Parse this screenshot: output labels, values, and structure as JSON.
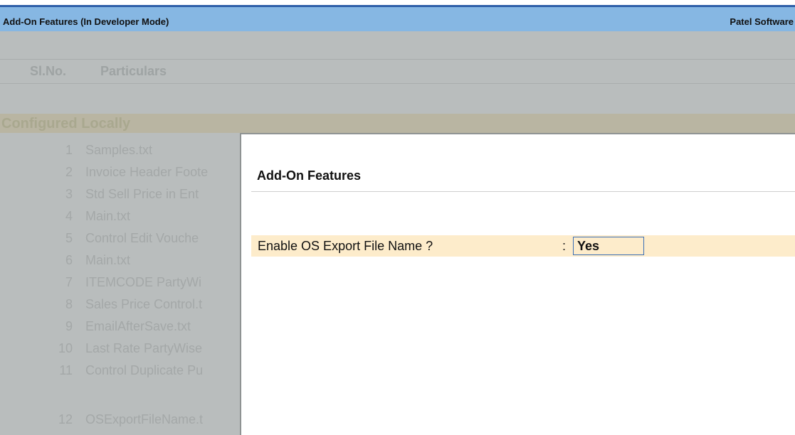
{
  "header": {
    "title": "Add-On Features (In Developer Mode)",
    "company": "Patel Software"
  },
  "list": {
    "col_slno": "Sl.No.",
    "col_particulars": "Particulars",
    "section": "Configured Locally",
    "rows": [
      {
        "num": "1",
        "name": "Samples.txt"
      },
      {
        "num": "2",
        "name": "Invoice Header Foote"
      },
      {
        "num": "3",
        "name": "Std Sell Price in Ent"
      },
      {
        "num": "4",
        "name": "Main.txt"
      },
      {
        "num": "5",
        "name": "Control Edit Vouche"
      },
      {
        "num": "6",
        "name": "Main.txt"
      },
      {
        "num": "7",
        "name": "ITEMCODE PartyWi"
      },
      {
        "num": "8",
        "name": "Sales Price Control.t"
      },
      {
        "num": "9",
        "name": "EmailAfterSave.txt"
      },
      {
        "num": "10",
        "name": "Last Rate PartyWise"
      },
      {
        "num": "11",
        "name": "Control Duplicate Pu"
      },
      {
        "num": "12",
        "name": "OSExportFileName.t"
      }
    ]
  },
  "dialog": {
    "title": "Add-On Features",
    "field_label": "Enable OS Export File Name ?",
    "colon": ":",
    "field_value": "Yes"
  }
}
